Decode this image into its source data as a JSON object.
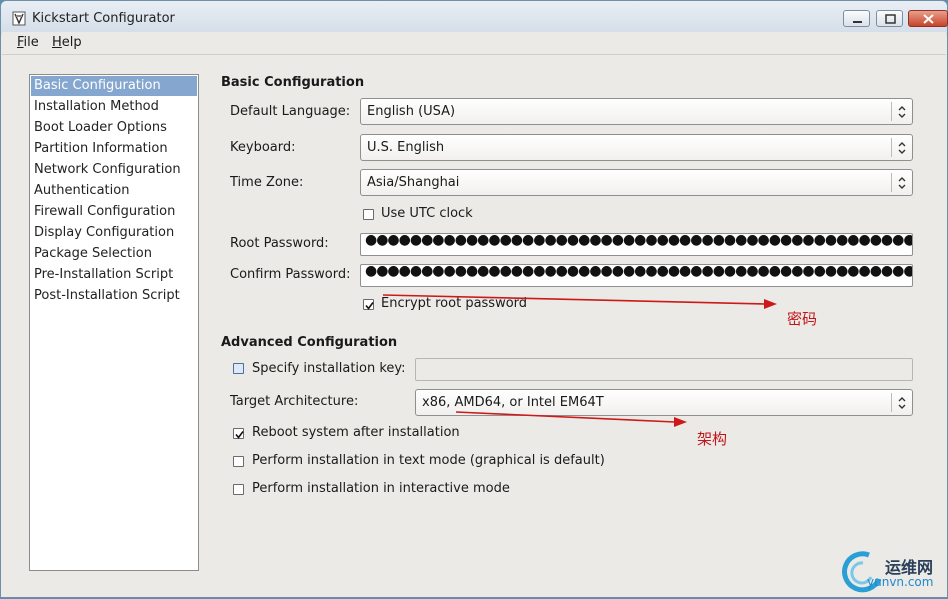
{
  "window": {
    "title": "Kickstart Configurator"
  },
  "menubar": {
    "file": {
      "mnemonic": "F",
      "rest": "ile"
    },
    "help": {
      "mnemonic": "H",
      "rest": "elp"
    }
  },
  "sidebar": {
    "items": [
      {
        "label": "Basic Configuration",
        "selected": true
      },
      {
        "label": "Installation Method"
      },
      {
        "label": "Boot Loader Options"
      },
      {
        "label": "Partition Information"
      },
      {
        "label": "Network Configuration"
      },
      {
        "label": "Authentication"
      },
      {
        "label": "Firewall Configuration"
      },
      {
        "label": "Display Configuration"
      },
      {
        "label": "Package Selection"
      },
      {
        "label": "Pre-Installation Script"
      },
      {
        "label": "Post-Installation Script"
      }
    ]
  },
  "basic": {
    "title": "Basic Configuration",
    "default_language": {
      "label": "Default Language:",
      "value": "English (USA)"
    },
    "keyboard": {
      "label": "Keyboard:",
      "value": "U.S. English"
    },
    "time_zone": {
      "label": "Time Zone:",
      "value": "Asia/Shanghai"
    },
    "utc_clock": {
      "label": "Use UTC clock",
      "checked": false
    },
    "root_password": {
      "label": "Root Password:",
      "value": "●●●●●●●●●●●●●●●●●●●●●●●●●●●●●●●●●●●●●●●●●●●●●●●●●●●●●●●●●●●●●●●●●●●"
    },
    "confirm_password": {
      "label": "Confirm Password:",
      "value": "●●●●●●●●●●●●●●●●●●●●●●●●●●●●●●●●●●●●●●●●●●●●●●●●●●●●●●●●●●●●●●●●●●●"
    },
    "encrypt": {
      "label": "Encrypt root password",
      "checked": true
    }
  },
  "advanced": {
    "title": "Advanced Configuration",
    "install_key": {
      "label": "Specify installation key:",
      "value": "",
      "checked": false
    },
    "target_arch": {
      "label": "Target Architecture:",
      "value": "x86, AMD64, or Intel EM64T"
    },
    "reboot": {
      "label": "Reboot system after installation",
      "checked": true
    },
    "text_mode": {
      "label": "Perform installation in text mode (graphical is default)",
      "checked": false
    },
    "interactive": {
      "label": "Perform installation in interactive mode",
      "checked": false
    }
  },
  "annotations": {
    "password_note": "密码",
    "arch_note": "架构",
    "color": "#cc1a1a"
  },
  "watermark": {
    "cn": "运维网",
    "url": "yunvn.com"
  }
}
